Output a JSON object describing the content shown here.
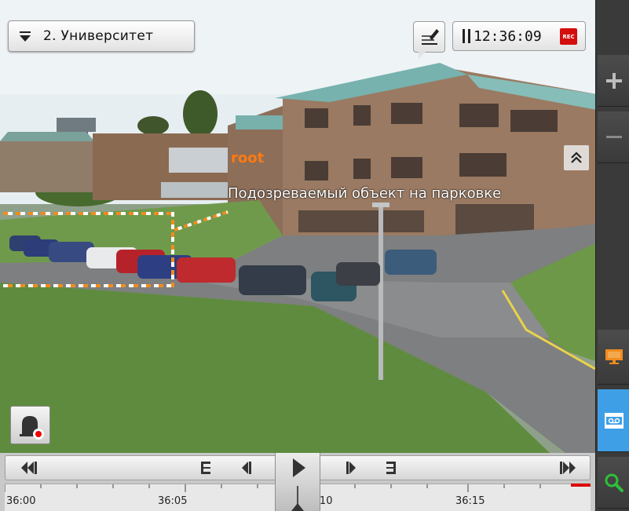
{
  "camera": {
    "selector_label": "2. Университет"
  },
  "time": {
    "current": "12:36:09",
    "rec_label": "REC"
  },
  "annotation": {
    "user": "root",
    "text": "Подозреваемый объект на парковке"
  },
  "timeline": {
    "ticks": [
      "36:00",
      "36:05",
      "36:10",
      "36:15"
    ]
  },
  "colors": {
    "accent_blue": "#3f9fe6",
    "rec_red": "#d40d0d",
    "annotation_orange": "#ff7a10",
    "zone_dash": "#f08c1e"
  },
  "icons": {
    "camera_menu": "triangle-down-icon",
    "comment": "comment-bubble-icon",
    "pause": "pause-icon",
    "collapse": "double-chevron-up-icon",
    "alarm": "bell-alarm-icon",
    "zoom_in": "plus-icon",
    "zoom_out": "minus-icon",
    "monitor": "monitor-icon",
    "archive": "film-archive-icon",
    "search": "search-icon"
  }
}
